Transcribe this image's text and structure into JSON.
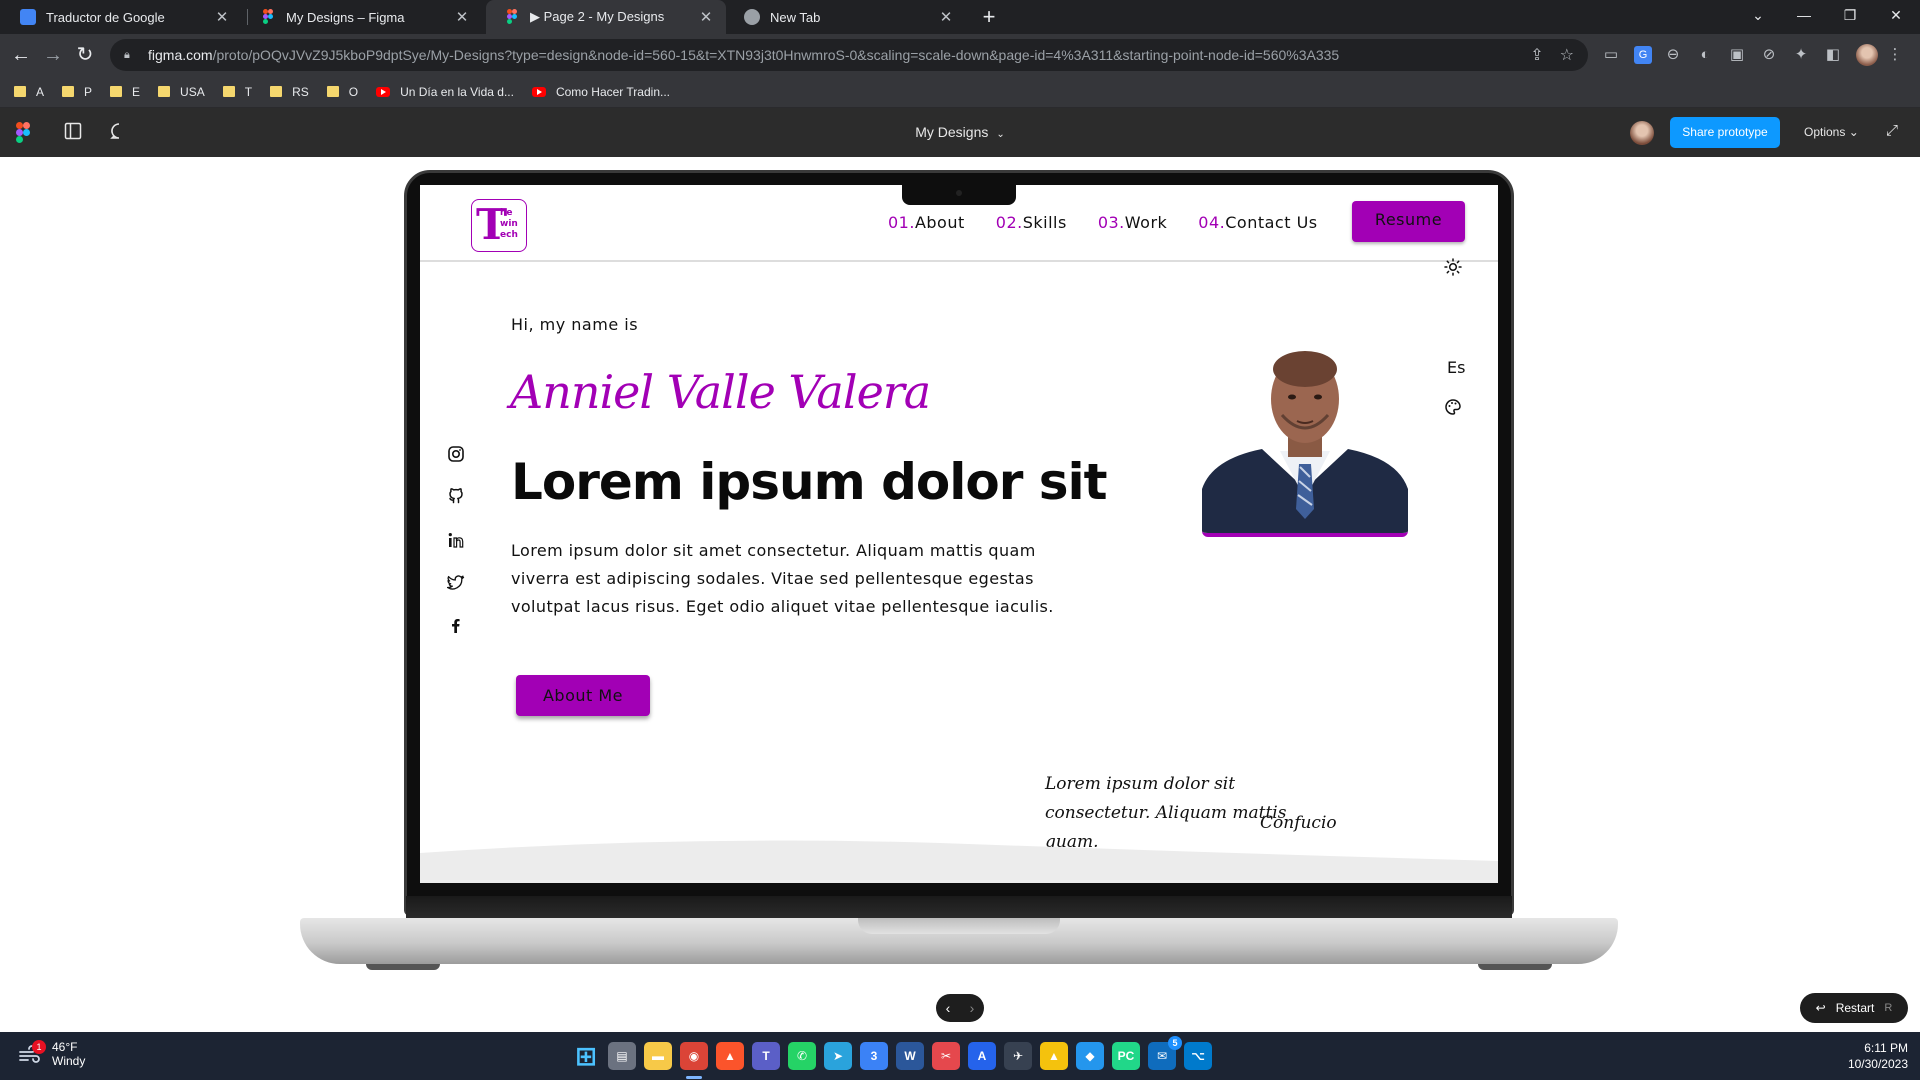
{
  "browser": {
    "tabs": [
      {
        "title": "Traductor de Google",
        "favicon": "google-translate-icon",
        "color": "#4285f4"
      },
      {
        "title": "My Designs – Figma",
        "favicon": "figma-icon",
        "color": "#f24e1e"
      },
      {
        "title": "▶ Page 2 - My Designs",
        "favicon": "figma-icon",
        "color": "#f24e1e",
        "active": true
      },
      {
        "title": "New Tab",
        "favicon": "chrome-icon",
        "color": "#9aa0a6"
      }
    ],
    "url_host": "figma.com",
    "url_path": "/proto/pOQvJVvZ9J5kboP9dptSye/My-Designs?type=design&node-id=560-15&t=XTN93j3t0HnwmroS-0&scaling=scale-down&page-id=4%3A311&starting-point-node-id=560%3A335",
    "bookmarks": [
      {
        "label": "A",
        "kind": "folder"
      },
      {
        "label": "P",
        "kind": "folder"
      },
      {
        "label": "E",
        "kind": "folder"
      },
      {
        "label": "USA",
        "kind": "folder"
      },
      {
        "label": "T",
        "kind": "folder"
      },
      {
        "label": "RS",
        "kind": "folder"
      },
      {
        "label": "O",
        "kind": "folder"
      },
      {
        "label": "Un Día en la Vida d...",
        "kind": "youtube"
      },
      {
        "label": "Como Hacer Tradin...",
        "kind": "youtube"
      }
    ]
  },
  "figma": {
    "title": "My Designs",
    "share_label": "Share prototype",
    "options_label": "Options"
  },
  "site": {
    "accent": "#a200b5",
    "logo": {
      "big": "T",
      "small": "he\nwin\nech"
    },
    "nav": [
      {
        "num": "01.",
        "label": "About"
      },
      {
        "num": "02.",
        "label": "Skills"
      },
      {
        "num": "03.",
        "label": "Work"
      },
      {
        "num": "04.",
        "label": "Contact Us"
      }
    ],
    "resume_label": "Resume",
    "greeting": "Hi, my name is",
    "name": "Anniel Valle Valera",
    "headline": "Lorem ipsum dolor sit",
    "intro": "Lorem ipsum dolor sit amet consectetur. Aliquam mattis quam viverra est adipiscing sodales. Vitae sed pellentesque egestas volutpat lacus risus. Eget odio aliquet vitae pellentesque iaculis.",
    "about_label": "About Me",
    "language": "Es",
    "quote": "Lorem ipsum dolor sit consectetur. Aliquam mattis quam.",
    "quote_author": "Confucio",
    "socials": [
      "instagram-icon",
      "github-icon",
      "linkedin-icon",
      "twitter-icon",
      "facebook-icon"
    ]
  },
  "proto_controls": {
    "restart_label": "Restart",
    "restart_key": "R"
  },
  "taskbar": {
    "weather_temp": "46°F",
    "weather_desc": "Windy",
    "weather_badge": "1",
    "time": "6:11 PM",
    "date": "10/30/2023",
    "apps": [
      {
        "name": "windows-start-icon",
        "color": "#4cc2ff"
      },
      {
        "name": "task-view-icon",
        "color": "#6b7280"
      },
      {
        "name": "file-explorer-icon",
        "color": "#f7c948"
      },
      {
        "name": "chrome-icon",
        "color": "#db4437"
      },
      {
        "name": "brave-icon",
        "color": "#fb542b"
      },
      {
        "name": "teams-icon",
        "color": "#5b5fc7"
      },
      {
        "name": "whatsapp-icon",
        "color": "#25d366"
      },
      {
        "name": "telegram-icon",
        "color": "#2aa3dc"
      },
      {
        "name": "app-3-icon",
        "color": "#3b82f6"
      },
      {
        "name": "word-icon",
        "color": "#2b579a"
      },
      {
        "name": "snipping-tool-icon",
        "color": "#e5484d"
      },
      {
        "name": "app-a-icon",
        "color": "#2563eb"
      },
      {
        "name": "plane-app-icon",
        "color": "#374151"
      },
      {
        "name": "autocad-icon",
        "color": "#f4c20d"
      },
      {
        "name": "docker-icon",
        "color": "#2496ed"
      },
      {
        "name": "pycharm-icon",
        "color": "#21d789"
      },
      {
        "name": "outlook-icon",
        "color": "#0f6cbd"
      },
      {
        "name": "vscode-icon",
        "color": "#007acc"
      }
    ],
    "outlook_badge": "5"
  }
}
